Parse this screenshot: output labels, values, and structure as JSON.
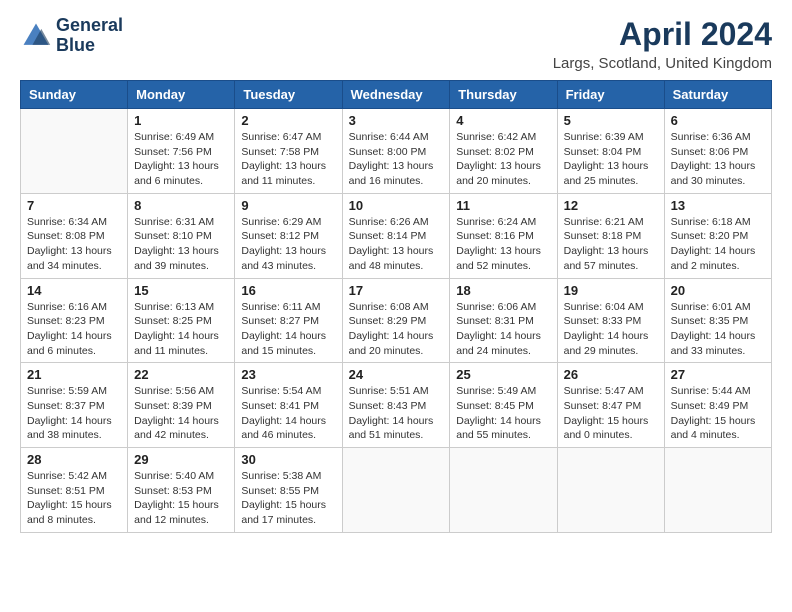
{
  "logo": {
    "line1": "General",
    "line2": "Blue"
  },
  "title": "April 2024",
  "subtitle": "Largs, Scotland, United Kingdom",
  "days_of_week": [
    "Sunday",
    "Monday",
    "Tuesday",
    "Wednesday",
    "Thursday",
    "Friday",
    "Saturday"
  ],
  "weeks": [
    [
      {
        "num": "",
        "info": ""
      },
      {
        "num": "1",
        "info": "Sunrise: 6:49 AM\nSunset: 7:56 PM\nDaylight: 13 hours\nand 6 minutes."
      },
      {
        "num": "2",
        "info": "Sunrise: 6:47 AM\nSunset: 7:58 PM\nDaylight: 13 hours\nand 11 minutes."
      },
      {
        "num": "3",
        "info": "Sunrise: 6:44 AM\nSunset: 8:00 PM\nDaylight: 13 hours\nand 16 minutes."
      },
      {
        "num": "4",
        "info": "Sunrise: 6:42 AM\nSunset: 8:02 PM\nDaylight: 13 hours\nand 20 minutes."
      },
      {
        "num": "5",
        "info": "Sunrise: 6:39 AM\nSunset: 8:04 PM\nDaylight: 13 hours\nand 25 minutes."
      },
      {
        "num": "6",
        "info": "Sunrise: 6:36 AM\nSunset: 8:06 PM\nDaylight: 13 hours\nand 30 minutes."
      }
    ],
    [
      {
        "num": "7",
        "info": "Sunrise: 6:34 AM\nSunset: 8:08 PM\nDaylight: 13 hours\nand 34 minutes."
      },
      {
        "num": "8",
        "info": "Sunrise: 6:31 AM\nSunset: 8:10 PM\nDaylight: 13 hours\nand 39 minutes."
      },
      {
        "num": "9",
        "info": "Sunrise: 6:29 AM\nSunset: 8:12 PM\nDaylight: 13 hours\nand 43 minutes."
      },
      {
        "num": "10",
        "info": "Sunrise: 6:26 AM\nSunset: 8:14 PM\nDaylight: 13 hours\nand 48 minutes."
      },
      {
        "num": "11",
        "info": "Sunrise: 6:24 AM\nSunset: 8:16 PM\nDaylight: 13 hours\nand 52 minutes."
      },
      {
        "num": "12",
        "info": "Sunrise: 6:21 AM\nSunset: 8:18 PM\nDaylight: 13 hours\nand 57 minutes."
      },
      {
        "num": "13",
        "info": "Sunrise: 6:18 AM\nSunset: 8:20 PM\nDaylight: 14 hours\nand 2 minutes."
      }
    ],
    [
      {
        "num": "14",
        "info": "Sunrise: 6:16 AM\nSunset: 8:23 PM\nDaylight: 14 hours\nand 6 minutes."
      },
      {
        "num": "15",
        "info": "Sunrise: 6:13 AM\nSunset: 8:25 PM\nDaylight: 14 hours\nand 11 minutes."
      },
      {
        "num": "16",
        "info": "Sunrise: 6:11 AM\nSunset: 8:27 PM\nDaylight: 14 hours\nand 15 minutes."
      },
      {
        "num": "17",
        "info": "Sunrise: 6:08 AM\nSunset: 8:29 PM\nDaylight: 14 hours\nand 20 minutes."
      },
      {
        "num": "18",
        "info": "Sunrise: 6:06 AM\nSunset: 8:31 PM\nDaylight: 14 hours\nand 24 minutes."
      },
      {
        "num": "19",
        "info": "Sunrise: 6:04 AM\nSunset: 8:33 PM\nDaylight: 14 hours\nand 29 minutes."
      },
      {
        "num": "20",
        "info": "Sunrise: 6:01 AM\nSunset: 8:35 PM\nDaylight: 14 hours\nand 33 minutes."
      }
    ],
    [
      {
        "num": "21",
        "info": "Sunrise: 5:59 AM\nSunset: 8:37 PM\nDaylight: 14 hours\nand 38 minutes."
      },
      {
        "num": "22",
        "info": "Sunrise: 5:56 AM\nSunset: 8:39 PM\nDaylight: 14 hours\nand 42 minutes."
      },
      {
        "num": "23",
        "info": "Sunrise: 5:54 AM\nSunset: 8:41 PM\nDaylight: 14 hours\nand 46 minutes."
      },
      {
        "num": "24",
        "info": "Sunrise: 5:51 AM\nSunset: 8:43 PM\nDaylight: 14 hours\nand 51 minutes."
      },
      {
        "num": "25",
        "info": "Sunrise: 5:49 AM\nSunset: 8:45 PM\nDaylight: 14 hours\nand 55 minutes."
      },
      {
        "num": "26",
        "info": "Sunrise: 5:47 AM\nSunset: 8:47 PM\nDaylight: 15 hours\nand 0 minutes."
      },
      {
        "num": "27",
        "info": "Sunrise: 5:44 AM\nSunset: 8:49 PM\nDaylight: 15 hours\nand 4 minutes."
      }
    ],
    [
      {
        "num": "28",
        "info": "Sunrise: 5:42 AM\nSunset: 8:51 PM\nDaylight: 15 hours\nand 8 minutes."
      },
      {
        "num": "29",
        "info": "Sunrise: 5:40 AM\nSunset: 8:53 PM\nDaylight: 15 hours\nand 12 minutes."
      },
      {
        "num": "30",
        "info": "Sunrise: 5:38 AM\nSunset: 8:55 PM\nDaylight: 15 hours\nand 17 minutes."
      },
      {
        "num": "",
        "info": ""
      },
      {
        "num": "",
        "info": ""
      },
      {
        "num": "",
        "info": ""
      },
      {
        "num": "",
        "info": ""
      }
    ]
  ]
}
